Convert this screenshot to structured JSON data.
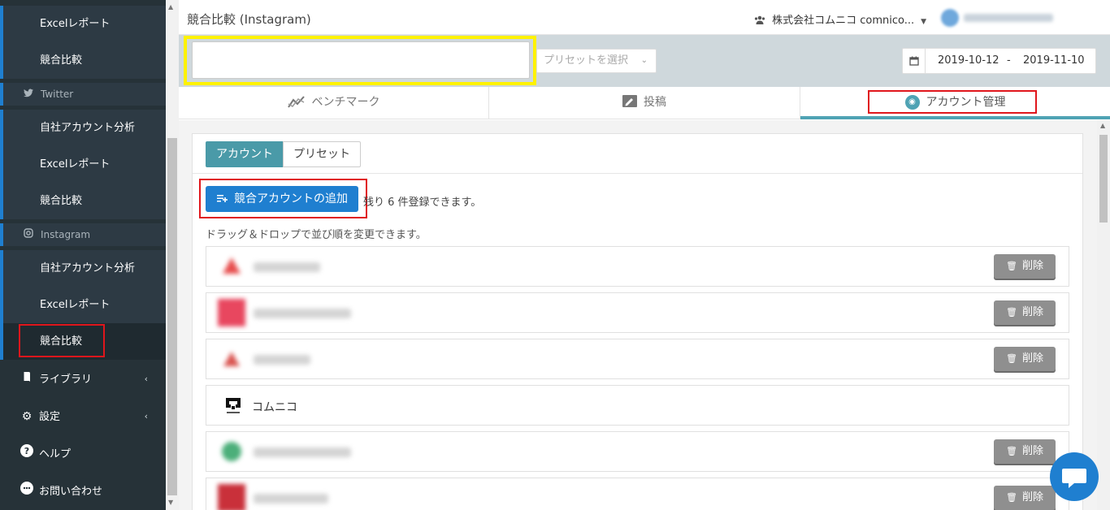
{
  "sidebar": {
    "facebook_sub": [
      {
        "label": "Excelレポート"
      },
      {
        "label": "競合比較"
      }
    ],
    "twitter": {
      "group_label": "Twitter",
      "items": [
        {
          "label": "自社アカウント分析"
        },
        {
          "label": "Excelレポート"
        },
        {
          "label": "競合比較"
        }
      ]
    },
    "instagram": {
      "group_label": "Instagram",
      "items": [
        {
          "label": "自社アカウント分析"
        },
        {
          "label": "Excelレポート"
        },
        {
          "label": "競合比較"
        }
      ]
    },
    "main_items": [
      {
        "label": "ライブラリ",
        "icon": "book-icon"
      },
      {
        "label": "設定",
        "icon": "gear-icon"
      },
      {
        "label": "ヘルプ",
        "icon": "help-icon"
      },
      {
        "label": "お問い合わせ",
        "icon": "contact-icon"
      }
    ]
  },
  "header": {
    "title": "競合比較 (Instagram)",
    "company": "株式会社コムニコ comnico..."
  },
  "filters": {
    "search_value": "",
    "preset_placeholder": "プリセットを選択",
    "date_from": "2019-10-12",
    "date_sep": "-",
    "date_to": "2019-11-10"
  },
  "tabs": [
    {
      "label": "ベンチマーク",
      "icon": "chart-line-icon"
    },
    {
      "label": "投稿",
      "icon": "post-icon"
    },
    {
      "label": "アカウント管理",
      "icon": "instagram-icon"
    }
  ],
  "panel": {
    "seg_account": "アカウント",
    "seg_preset": "プリセット",
    "add_button": "競合アカウントの追加",
    "remaining": "残り 6 件登録できます。",
    "dnd_hint": "ドラッグ＆ドロップで並び順を変更できます。",
    "delete_label": "削除",
    "visible_account": "コムニコ"
  },
  "colors": {
    "sidebar_bg": "#263238",
    "accent_blue": "#1f7fd0",
    "teal": "#4a9aa8",
    "filter_bg": "#cfd8dc",
    "highlight_red": "#e0161c",
    "highlight_yellow": "#fff200"
  }
}
